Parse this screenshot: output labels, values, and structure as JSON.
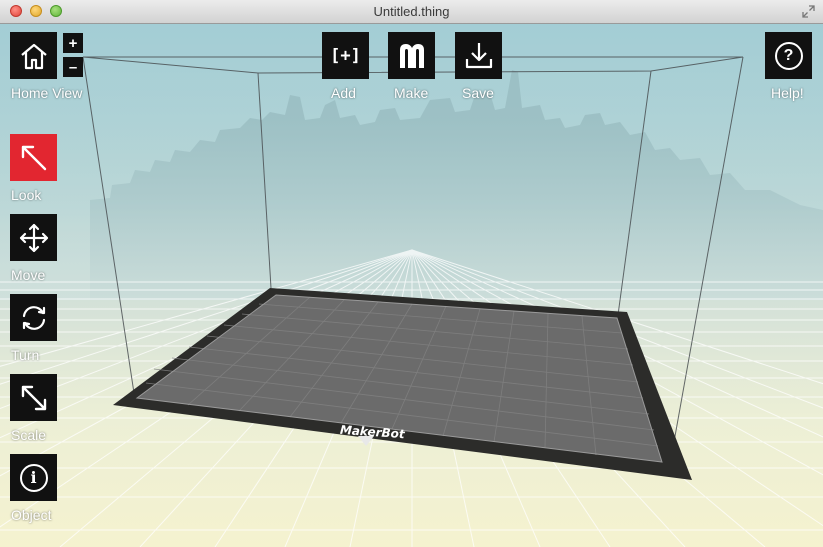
{
  "window": {
    "title": "Untitled.thing"
  },
  "toolbar": {
    "home_label": "Home View",
    "zoom_in": "+",
    "zoom_out": "–",
    "add_label": "Add",
    "add_icon_text": "[+]",
    "make_label": "Make",
    "save_label": "Save",
    "help_label": "Help!",
    "help_icon_text": "?"
  },
  "tools": {
    "look_label": "Look",
    "move_label": "Move",
    "turn_label": "Turn",
    "scale_label": "Scale",
    "object_label": "Object",
    "object_icon_text": "i"
  },
  "platform": {
    "brand": "MakerBot"
  },
  "colors": {
    "active_tool": "#e22630",
    "button": "#111111"
  },
  "icons": [
    "home-icon",
    "add-icon",
    "makerbot-m-icon",
    "save-icon",
    "help-icon",
    "look-arrow-icon",
    "move-arrows-icon",
    "turn-arrows-icon",
    "scale-arrow-icon",
    "object-info-icon"
  ]
}
